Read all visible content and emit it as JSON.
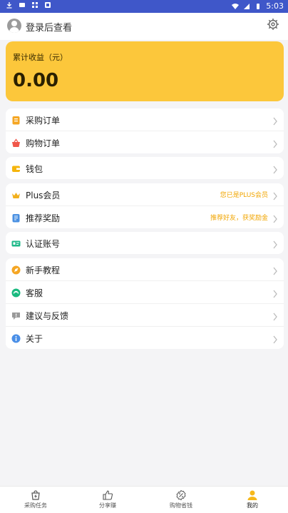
{
  "status_bar": {
    "time": "5:03"
  },
  "header": {
    "login_text": "登录后查看"
  },
  "earnings": {
    "label": "累计收益（元）",
    "value": "0.00"
  },
  "groups": [
    {
      "items": [
        {
          "label": "采购订单",
          "icon": "clipboard-icon"
        },
        {
          "label": "购物订单",
          "icon": "basket-icon"
        }
      ]
    },
    {
      "items": [
        {
          "label": "钱包",
          "icon": "wallet-icon"
        }
      ]
    },
    {
      "items": [
        {
          "label": "Plus会员",
          "icon": "crown-icon",
          "note": "您已是PLUS会员"
        },
        {
          "label": "推荐奖励",
          "icon": "reward-icon",
          "note": "推荐好友，获奖励金"
        }
      ]
    },
    {
      "items": [
        {
          "label": "认证账号",
          "icon": "id-card-icon"
        }
      ]
    },
    {
      "items": [
        {
          "label": "新手教程",
          "icon": "compass-icon"
        },
        {
          "label": "客服",
          "icon": "support-icon"
        },
        {
          "label": "建议与反馈",
          "icon": "feedback-icon"
        },
        {
          "label": "关于",
          "icon": "info-icon"
        }
      ]
    }
  ],
  "tabs": [
    {
      "label": "采购任务",
      "icon": "bag-icon"
    },
    {
      "label": "分享赚",
      "icon": "thumbs-up-icon"
    },
    {
      "label": "购物省钱",
      "icon": "percent-icon"
    },
    {
      "label": "我的",
      "icon": "user-icon",
      "active": true
    }
  ],
  "colors": {
    "statusbar": "#3f57c9",
    "accent": "#fcc73b",
    "note": "#f1a500"
  }
}
